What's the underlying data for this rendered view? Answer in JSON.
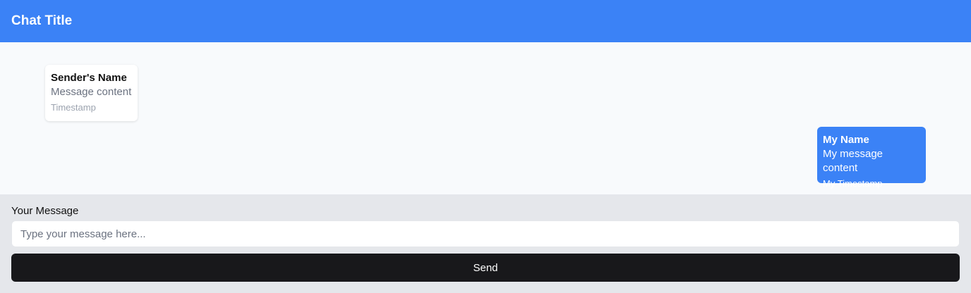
{
  "header": {
    "title": "Chat Title",
    "background": "#3b82f6"
  },
  "messages": [
    {
      "sender": "Sender's Name",
      "content": "Message content",
      "timestamp": "Timestamp",
      "direction": "received"
    },
    {
      "sender": "My Name",
      "content": "My message content",
      "timestamp": "My Timestamp",
      "direction": "sent"
    }
  ],
  "composer": {
    "label": "Your Message",
    "placeholder": "Type your message here...",
    "value": "",
    "send_label": "Send"
  },
  "colors": {
    "accent": "#3b82f6",
    "button": "#18181b",
    "composer_bg": "#e5e7eb"
  }
}
